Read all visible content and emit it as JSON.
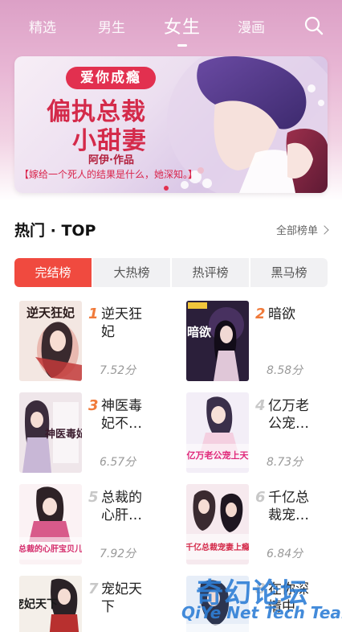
{
  "nav": {
    "tabs": [
      "精选",
      "男生",
      "女生",
      "漫画"
    ],
    "active_index": 2
  },
  "banner": {
    "tag": "爱你成瘾",
    "title_line1": "偏执总裁",
    "title_line2": "小甜妻",
    "author": "阿伊·作品",
    "quote": "【嫁给一个死人的结果是什么，她深知。】"
  },
  "section": {
    "title": "热门 · TOP",
    "more_label": "全部榜单"
  },
  "subtabs": [
    "完结榜",
    "大热榜",
    "热评榜",
    "黑马榜"
  ],
  "books": [
    {
      "rank": "1",
      "name": "逆天狂妃",
      "score": "7.52分",
      "cover_text": "逆天狂妃"
    },
    {
      "rank": "2",
      "name": "暗欲",
      "score": "8.58分",
      "cover_text": "暗欲"
    },
    {
      "rank": "3",
      "name": "神医毒妃不…",
      "score": "6.57分",
      "cover_text": "神医毒妃"
    },
    {
      "rank": "4",
      "name": "亿万老公宠…",
      "score": "8.73分",
      "cover_text": "亿万老公宠上天"
    },
    {
      "rank": "5",
      "name": "总裁的心肝…",
      "score": "7.92分",
      "cover_text": "总裁的心肝宝贝儿"
    },
    {
      "rank": "6",
      "name": "千亿总裁宠…",
      "score": "6.84分",
      "cover_text": "千亿总裁宠妻上瘾"
    },
    {
      "rank": "7",
      "name": "宠妃天下",
      "score": "",
      "cover_text": "宠妃天下"
    },
    {
      "rank": "8",
      "name": "在你深情中",
      "score": "",
      "cover_text": ""
    }
  ],
  "watermark": {
    "cn": "奇幻论坛",
    "en": "QiYe Net Tech Team"
  },
  "colors": {
    "accent": "#f04a3f",
    "rank_hot": "#f07a3a",
    "header_pink": "#dca0c6"
  }
}
